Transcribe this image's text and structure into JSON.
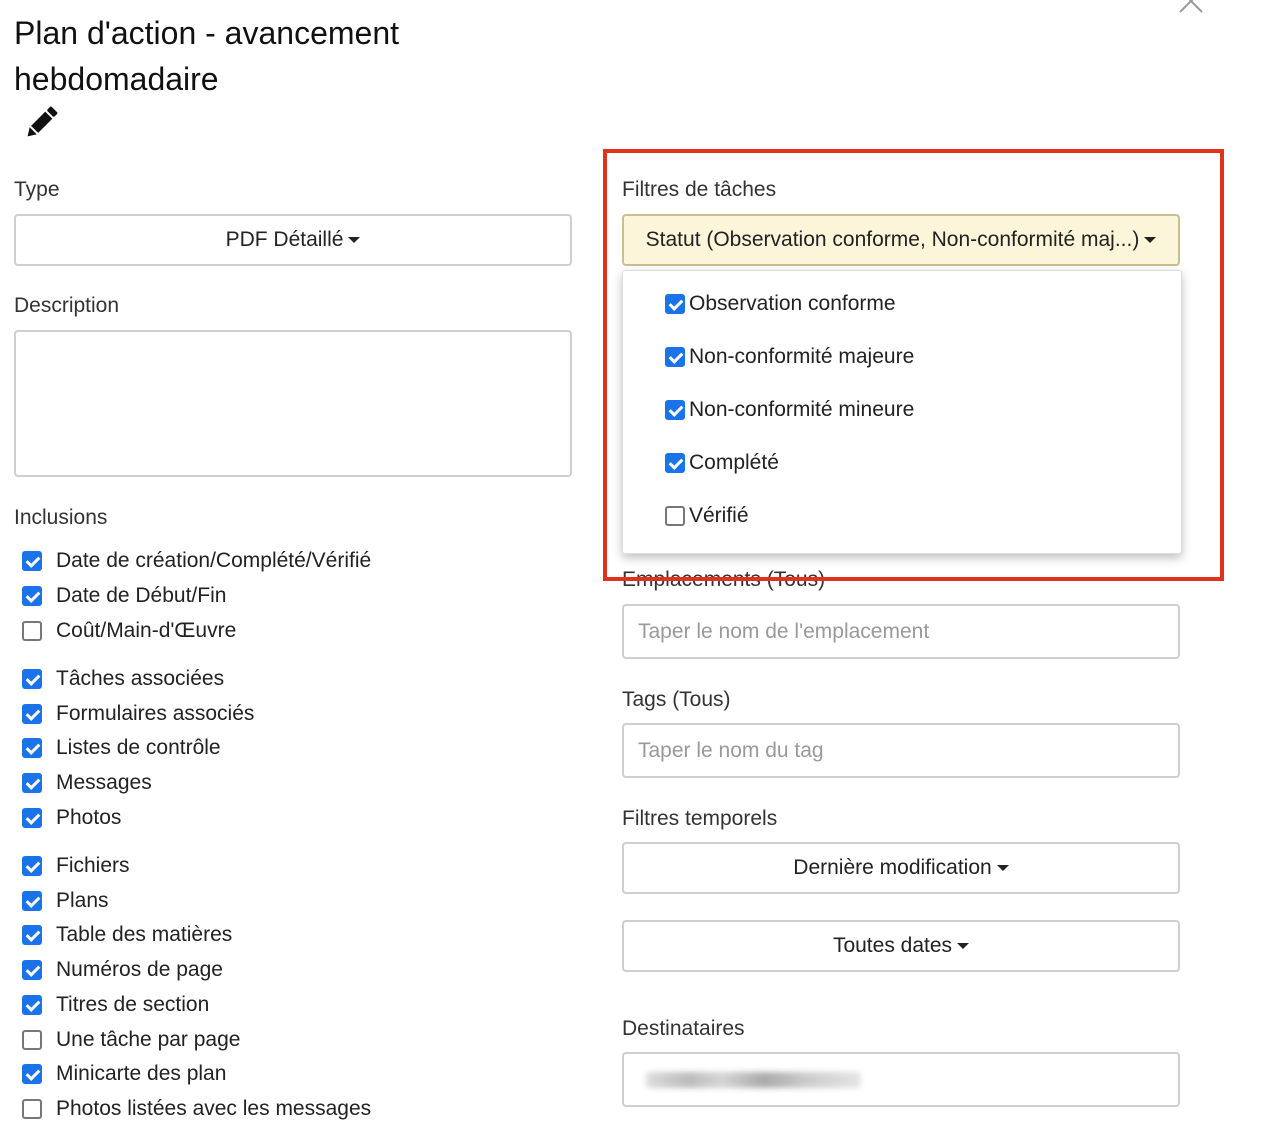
{
  "title": "Plan d'action - avancement hebdomadaire",
  "type": {
    "label": "Type",
    "value": "PDF Détaillé"
  },
  "description": {
    "label": "Description",
    "value": ""
  },
  "inclusions": {
    "label": "Inclusions",
    "items": [
      {
        "label": "Date de création/Complété/Vérifié",
        "checked": true
      },
      {
        "label": "Date de Début/Fin",
        "checked": true
      },
      {
        "label": "Coût/Main-d'Œuvre",
        "checked": false
      },
      {
        "label": "Tâches associées",
        "checked": true
      },
      {
        "label": "Formulaires associés",
        "checked": true
      },
      {
        "label": "Listes de contrôle",
        "checked": true
      },
      {
        "label": "Messages",
        "checked": true
      },
      {
        "label": "Photos",
        "checked": true
      },
      {
        "label": "Fichiers",
        "checked": true
      },
      {
        "label": "Plans",
        "checked": true
      },
      {
        "label": "Table des matières",
        "checked": true
      },
      {
        "label": "Numéros de page",
        "checked": true
      },
      {
        "label": "Titres de section",
        "checked": true
      },
      {
        "label": "Une tâche par page",
        "checked": false
      },
      {
        "label": "Minicarte des plan",
        "checked": true
      },
      {
        "label": "Photos listées avec les messages",
        "checked": false
      }
    ]
  },
  "task_filters": {
    "label": "Filtres de tâches",
    "status_button": "Statut (Observation conforme, Non-conformité maj...)",
    "status_options": [
      {
        "label": "Observation conforme",
        "checked": true
      },
      {
        "label": "Non-conformité majeure",
        "checked": true
      },
      {
        "label": "Non-conformité mineure",
        "checked": true
      },
      {
        "label": "Complété",
        "checked": true
      },
      {
        "label": "Vérifié",
        "checked": false
      }
    ]
  },
  "locations": {
    "label": "Emplacements (Tous)",
    "placeholder": "Taper le nom de l'emplacement"
  },
  "tags": {
    "label": "Tags (Tous)",
    "placeholder": "Taper le nom du tag"
  },
  "time_filters": {
    "label": "Filtres temporels",
    "modified": "Dernière modification",
    "dates": "Toutes dates"
  },
  "recipients": {
    "label": "Destinataires"
  },
  "colors": {
    "checkbox": "#1a73e8",
    "highlight": "#e0321f",
    "status_bg": "#fdf5da"
  }
}
